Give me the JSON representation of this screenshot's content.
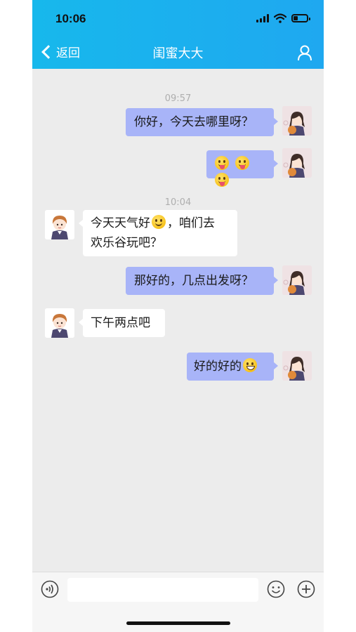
{
  "status_bar": {
    "time": "10:06"
  },
  "nav": {
    "back_label": "返回",
    "title": "闺蜜大大"
  },
  "messages": [
    {
      "type": "time",
      "text": "09:57"
    },
    {
      "type": "msg",
      "from": "me",
      "text": "你好，今天去哪里呀？"
    },
    {
      "type": "msg",
      "from": "me",
      "emojis": [
        "tongue-emoji",
        "tongue-emoji",
        "tongue-emoji"
      ]
    },
    {
      "type": "time",
      "text": "10:04"
    },
    {
      "type": "msg",
      "from": "them",
      "line1_a": "今天天气好",
      "line1_b": "，咱们去",
      "line2": "欢乐谷玩吧？"
    },
    {
      "type": "msg",
      "from": "me",
      "text": "那好的，几点出发呀？"
    },
    {
      "type": "msg",
      "from": "them",
      "text": "下午两点吧"
    },
    {
      "type": "msg",
      "from": "me",
      "text": "好的好的"
    }
  ],
  "input": {
    "value": "",
    "placeholder": ""
  },
  "colors": {
    "header": "#17b8ec",
    "my_bubble": "#a8b4f8",
    "their_bubble": "#ffffff",
    "chat_bg": "#ececec"
  }
}
